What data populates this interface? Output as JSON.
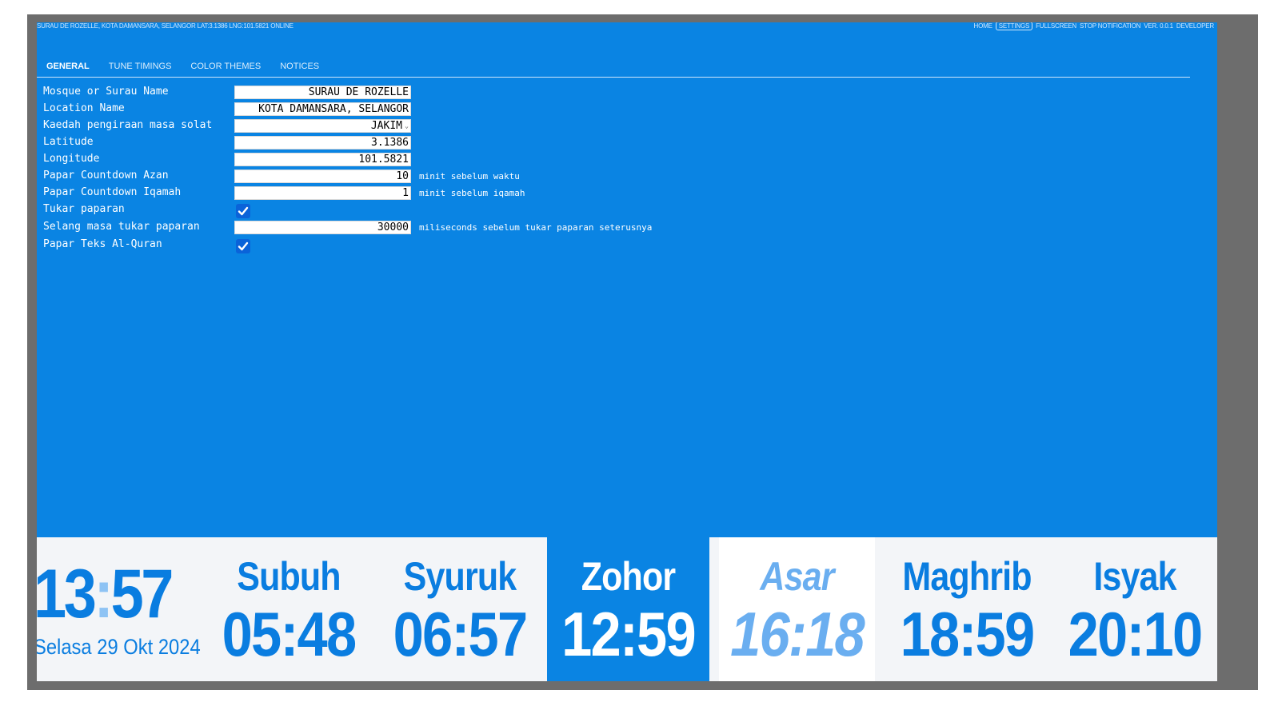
{
  "header": {
    "status_line": "SURAU DE ROZELLE, KOTA DAMANSARA, SELANGOR LAT:3.1386 LNG:101.5821 ONLINE",
    "nav": [
      {
        "label": "HOME"
      },
      {
        "label": "SETTINGS"
      },
      {
        "label": "FULLSCREEN"
      },
      {
        "label": "STOP NOTIFICATION"
      },
      {
        "label": "VER. 0.0.1"
      },
      {
        "label": "DEVELOPER"
      }
    ]
  },
  "tabs": [
    {
      "label": "GENERAL"
    },
    {
      "label": "TUNE TIMINGS"
    },
    {
      "label": "COLOR THEMES"
    },
    {
      "label": "NOTICES"
    }
  ],
  "form": {
    "mosque_name": {
      "label": "Mosque or Surau Name",
      "value": "SURAU DE ROZELLE"
    },
    "location_name": {
      "label": "Location Name",
      "value": "KOTA DAMANSARA, SELANGOR"
    },
    "method": {
      "label": "Kaedah pengiraan masa solat",
      "value": "JAKIM"
    },
    "latitude": {
      "label": "Latitude",
      "value": "3.1386"
    },
    "longitude": {
      "label": "Longitude",
      "value": "101.5821"
    },
    "countdown_azan": {
      "label": "Papar Countdown Azan",
      "value": "10",
      "hint": "minit sebelum waktu"
    },
    "countdown_iqamah": {
      "label": "Papar Countdown Iqamah",
      "value": "1",
      "hint": "minit sebelum iqamah"
    },
    "switch_display": {
      "label": "Tukar paparan",
      "checked": true
    },
    "switch_interval": {
      "label": "Selang masa tukar paparan",
      "value": "30000",
      "hint": "miliseconds sebelum tukar paparan seterusnya"
    },
    "show_quran": {
      "label": "Papar Teks Al-Quran",
      "checked": true
    }
  },
  "clock": {
    "hours": "13",
    "separator": ":",
    "minutes": "57",
    "date": "Selasa 29 Okt 2024"
  },
  "prayers": [
    {
      "name": "Subuh",
      "time": "05:48"
    },
    {
      "name": "Syuruk",
      "time": "06:57"
    },
    {
      "name": "Zohor",
      "time": "12:59"
    },
    {
      "name": "Asar",
      "time": "16:18"
    },
    {
      "name": "Maghrib",
      "time": "18:59"
    },
    {
      "name": "Isyak",
      "time": "20:10"
    }
  ],
  "colors": {
    "screen_bg": "#0a84e3",
    "accent_text": "#0a7de0",
    "bar_bg": "#f3f5f8",
    "next_prayer_text": "#6aaef0"
  }
}
